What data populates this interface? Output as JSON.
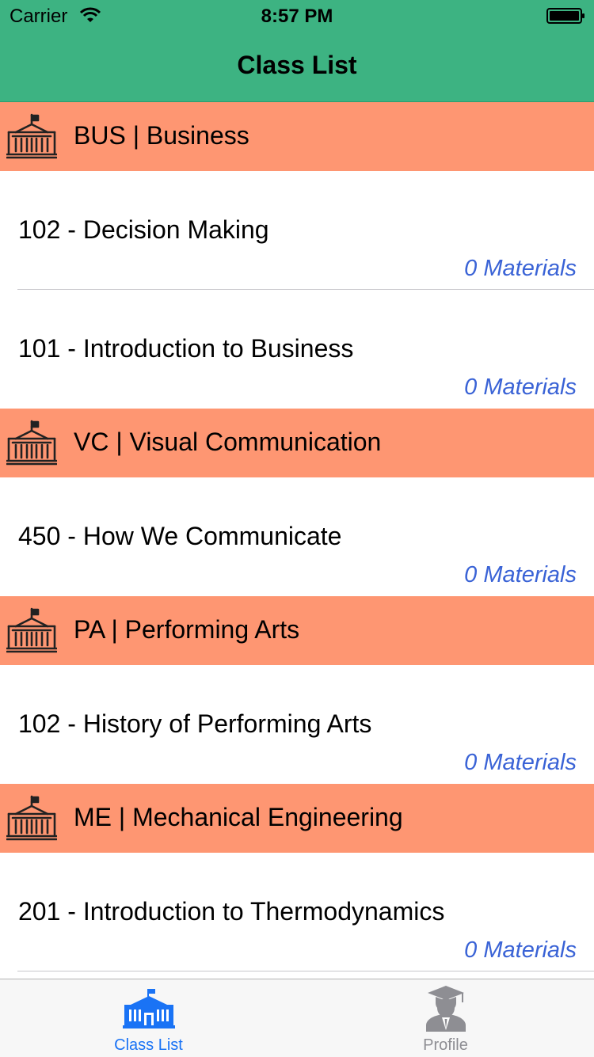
{
  "status_bar": {
    "carrier": "Carrier",
    "time": "8:57 PM",
    "wifi_icon": "wifi-icon",
    "battery_icon": "battery-icon"
  },
  "nav": {
    "title": "Class List",
    "background": "#3db382"
  },
  "sections": [
    {
      "title": "BUS | Business",
      "icon": "school-building-icon",
      "classes": [
        {
          "title": "102 - Decision Making",
          "materials": "0 Materials"
        },
        {
          "title": "101 - Introduction to Business",
          "materials": "0 Materials"
        }
      ]
    },
    {
      "title": "VC | Visual Communication",
      "icon": "school-building-icon",
      "classes": [
        {
          "title": "450 - How We Communicate",
          "materials": "0 Materials"
        }
      ]
    },
    {
      "title": "PA | Performing Arts",
      "icon": "school-building-icon",
      "classes": [
        {
          "title": "102 - History of Performing Arts",
          "materials": "0 Materials"
        }
      ]
    },
    {
      "title": "ME | Mechanical Engineering",
      "icon": "school-building-icon",
      "classes": [
        {
          "title": "201 - Introduction to Thermodynamics",
          "materials": "0 Materials"
        }
      ]
    }
  ],
  "colors": {
    "section_header": "#fe9672",
    "materials_text": "#3a63d6",
    "tab_active": "#1a73f5",
    "tab_inactive": "#8e8e93"
  },
  "tabs": [
    {
      "label": "Class List",
      "icon": "school-building-icon",
      "active": true
    },
    {
      "label": "Profile",
      "icon": "graduate-icon",
      "active": false
    }
  ]
}
